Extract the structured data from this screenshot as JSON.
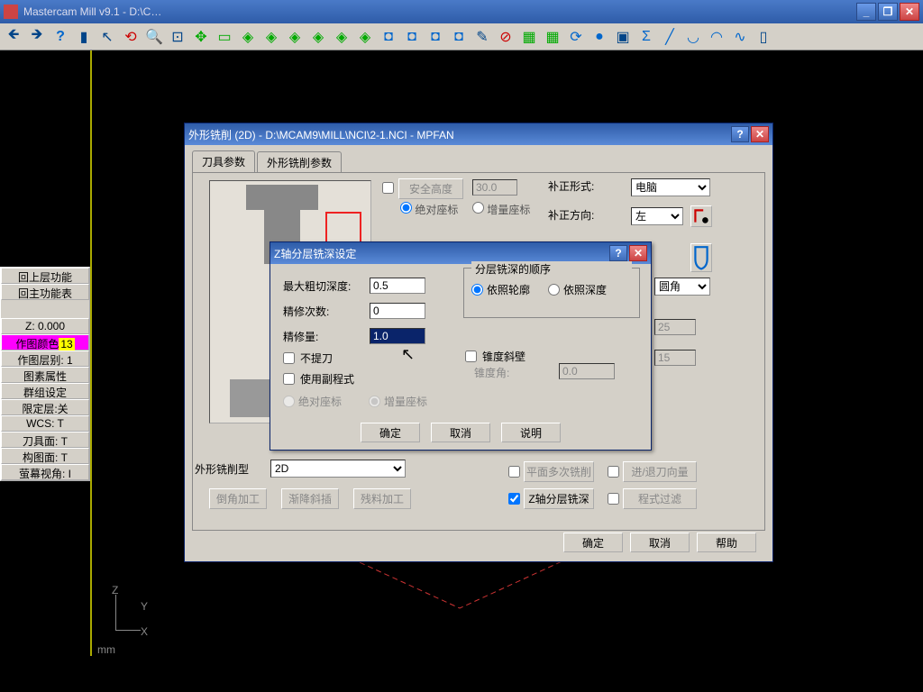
{
  "app": {
    "title": "Mastercam Mill v9.1 - D:\\C…"
  },
  "winbtns": {
    "min": "_",
    "max": "❐",
    "close": "✕"
  },
  "sidebar": [
    "回上层功能",
    "回主功能表",
    "Z: 0.000",
    "作图颜色",
    "作图层别: 1",
    "图素属性",
    "群组设定",
    "限定层:关",
    "WCS: T",
    "刀具面: T",
    "构图面: T",
    "萤幕视角: I"
  ],
  "sidebar_hlval": "13",
  "status_mm": "mm",
  "dialog1": {
    "title": "外形铣削 (2D) - D:\\MCAM9\\MILL\\NCI\\2-1.NCI - MPFAN",
    "tabs": [
      "刀具参数",
      "外形铣削参数"
    ],
    "safe_height_btn": "安全高度",
    "safe_height_val": "30.0",
    "abs": "绝对座标",
    "inc": "增量座标",
    "comp_mode": "补正形式:",
    "comp_sel": "电脑",
    "comp_dir": "补正方向:",
    "dir_sel": "左",
    "corner": "圆角",
    "xyst": "25",
    "zst": "15",
    "type_lbl": "外形铣削型",
    "type_sel": "2D",
    "chamfer": "倒角加工",
    "ramp": "渐降斜插",
    "remach": "残料加工",
    "multipass": "平面多次铣削",
    "leadio": "进/退刀向量",
    "zdepth": "Z轴分层铣深",
    "filter": "程式过滤",
    "ok": "确定",
    "cancel": "取消",
    "help": "帮助"
  },
  "dialog2": {
    "title": "Z轴分层铣深设定",
    "max_rough": "最大粗切深度:",
    "max_rough_v": "0.5",
    "finish_n": "精修次数:",
    "finish_n_v": "0",
    "finish_amt": "精修量:",
    "finish_amt_v": "1.0",
    "no_retract": "不提刀",
    "sub": "使用副程式",
    "abs": "绝对座标",
    "inc": "增量座标",
    "order_legend": "分层铣深的顺序",
    "by_contour": "依照轮廓",
    "by_depth": "依照深度",
    "taper": "锥度斜壁",
    "taper_ang": "锥度角:",
    "taper_v": "0.0",
    "ok": "确定",
    "cancel": "取消",
    "explain": "说明"
  }
}
